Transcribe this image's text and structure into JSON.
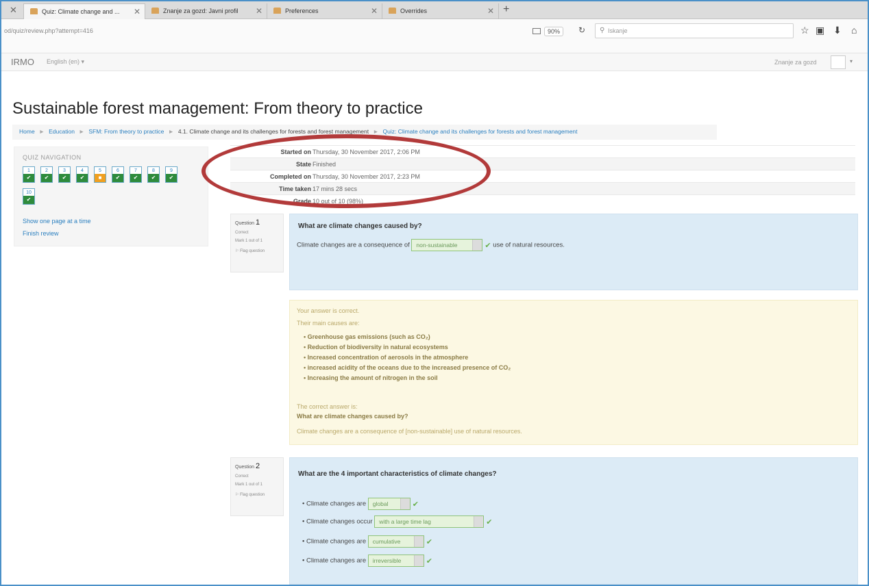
{
  "browser": {
    "tabs": [
      {
        "label": "Quiz: Climate change and ..."
      },
      {
        "label": "Znanje za gozd: Javni profil"
      },
      {
        "label": "Preferences"
      },
      {
        "label": "Overrides"
      }
    ],
    "url": "od/quiz/review.php?attempt=416",
    "zoom": "90%",
    "search_placeholder": "Iskanje"
  },
  "site": {
    "brand": "IRMO",
    "language": "English (en) ▾",
    "user_name": "Znanje za gozd"
  },
  "page": {
    "title": "Sustainable forest management: From theory to practice"
  },
  "breadcrumb": {
    "home": "Home",
    "education": "Education",
    "course": "SFM: From theory to practice",
    "section": "4.1. Climate change and its challenges for forests and forest management",
    "quiz": "Quiz: Climate change and its challenges for forests and forest management"
  },
  "quiz_navigation": {
    "title": "QUIZ NAVIGATION",
    "questions": [
      {
        "num": "1",
        "state": "correct"
      },
      {
        "num": "2",
        "state": "correct"
      },
      {
        "num": "3",
        "state": "correct"
      },
      {
        "num": "4",
        "state": "correct"
      },
      {
        "num": "5",
        "state": "partial"
      },
      {
        "num": "6",
        "state": "correct"
      },
      {
        "num": "7",
        "state": "correct"
      },
      {
        "num": "8",
        "state": "correct"
      },
      {
        "num": "9",
        "state": "correct"
      },
      {
        "num": "10",
        "state": "correct"
      }
    ],
    "show_one_page": "Show one page at a time",
    "finish_review": "Finish review"
  },
  "summary": [
    {
      "label": "Started on",
      "value": "Thursday, 30 November 2017, 2:06 PM"
    },
    {
      "label": "State",
      "value": "Finished"
    },
    {
      "label": "Completed on",
      "value": "Thursday, 30 November 2017, 2:23 PM"
    },
    {
      "label": "Time taken",
      "value": "17 mins 28 secs"
    },
    {
      "label": "Grade",
      "value": "10 out of 10 (98%)"
    }
  ],
  "question1": {
    "label": "Question",
    "number": "1",
    "status": "Correct",
    "mark": "Mark 1 out of 1",
    "flag": "Flag question",
    "text": "What are climate changes caused by?",
    "prefix": "Climate changes are a consequence of",
    "answer": "non-sustainable",
    "suffix": "use of natural resources.",
    "feedback": {
      "correct_msg": "Your answer is correct.",
      "causes_intro": "Their main causes are:",
      "causes": [
        "Greenhouse gas emissions (such as CO₂)",
        "Reduction of biodiversity in natural ecosystems",
        "Increased concentration of aerosols in the atmosphere",
        "increased acidity of the oceans due to the increased presence of CO₂",
        "Increasing the amount of nitrogen in the soil"
      ],
      "correct_answer_label": "The correct answer is:",
      "correct_answer_question": "What are climate changes caused by?",
      "correct_answer_text": "Climate changes are a consequence of [non-sustainable] use of natural resources."
    }
  },
  "question2": {
    "label": "Question",
    "number": "2",
    "status": "Correct",
    "mark": "Mark 1 out of 1",
    "flag": "Flag question",
    "text": "What are the 4 important characteristics of climate changes?",
    "items": [
      {
        "prefix": "Climate changes are",
        "answer": "global"
      },
      {
        "prefix": "Climate changes occur",
        "answer": "with a large time lag"
      },
      {
        "prefix": "Climate changes are",
        "answer": "cumulative"
      },
      {
        "prefix": "Climate changes are",
        "answer": "irreversible"
      }
    ]
  }
}
